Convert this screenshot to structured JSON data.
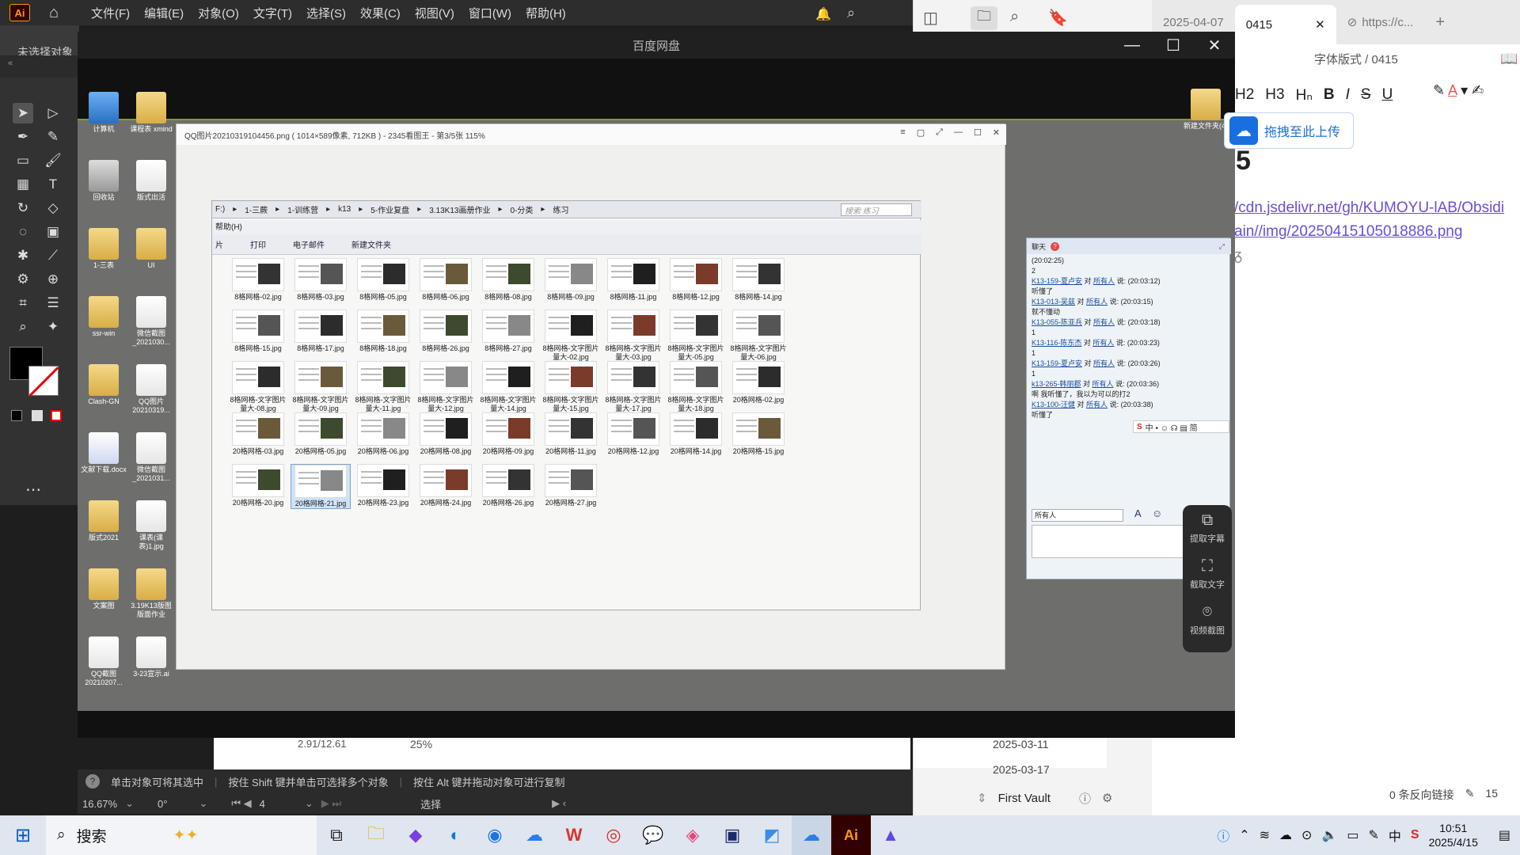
{
  "illustrator": {
    "logo": "Ai",
    "menus": [
      "文件(F)",
      "编辑(E)",
      "对象(O)",
      "文字(T)",
      "选择(S)",
      "效果(C)",
      "视图(V)",
      "窗口(W)",
      "帮助(H)"
    ],
    "no_selection": "未选择对象",
    "status": {
      "hint1": "单击对象可将其选中",
      "hint2": "按住 Shift 键并单击可选择多个对象",
      "hint3": "按住 Alt 键并拖动对象可进行复制"
    },
    "bottom": {
      "zoom": "16.67%",
      "rotate": "0°",
      "artboard": "4",
      "mode": "选择",
      "ruler_zero": "0"
    },
    "canvas_values": {
      "v1": "2.91/12.61",
      "v2": "25%"
    }
  },
  "obsidian": {
    "tabs": [
      {
        "label": "2025-04-07"
      },
      {
        "label": "0415",
        "active": true
      },
      {
        "label": "https://c..."
      }
    ],
    "breadcrumb": "字体版式 / 0415",
    "format_buttons": [
      "H2",
      "H3",
      "Hₙ",
      "B",
      "I",
      "S",
      "U"
    ],
    "heading": "5",
    "link_line1": "/cdn.jsdelivr.net/gh/KUMOYU-lAB/Obsidi",
    "link_line2": "ain//img/20250415105018886.png",
    "sidebar_dates": [
      "2025-03-11",
      "2025-03-17"
    ],
    "vault": "First Vault",
    "backlinks": "0 条反向链接",
    "word_count": "15"
  },
  "baidu": {
    "title": "百度网盘",
    "upload_label": "拖拽至此上传",
    "capture_tools": [
      "提取字幕",
      "截取文字",
      "视频截图"
    ]
  },
  "desktop_icons": [
    {
      "label": "计算机"
    },
    {
      "label": "课程表\nxmind"
    },
    {
      "label": "回收站"
    },
    {
      "label": "版式出活"
    },
    {
      "label": "1-三表"
    },
    {
      "label": "UI"
    },
    {
      "label": "ssr-win"
    },
    {
      "label": "微信截图_2021030..."
    },
    {
      "label": "Clash-GN"
    },
    {
      "label": "QQ图片20210319..."
    },
    {
      "label": "文献下载.docx"
    },
    {
      "label": "微信截图_2021031..."
    },
    {
      "label": "版式2021"
    },
    {
      "label": "课表(课表)1.jpg"
    },
    {
      "label": "文案图"
    },
    {
      "label": "3.19K13版图版面作业"
    },
    {
      "label": "QQ截图20210207..."
    },
    {
      "label": "3-23宣示.ai"
    }
  ],
  "right_desktop_icon": "新建文件夹(4)",
  "viewer": {
    "title": "QQ图片20210319104456.png ( 1014×589像素, 712KB ) - 2345看图王 - 第3/5张 115%"
  },
  "explorer": {
    "breadcrumb": [
      "F:)",
      "1-三蕨",
      "1-训练营",
      "k13",
      "5-作业复盘",
      "3.13K13画册作业",
      "0-分类",
      "练习"
    ],
    "search_placeholder": "搜索 练习",
    "menu": "帮助(H)",
    "toolbar": [
      "片",
      "打印",
      "电子邮件",
      "新建文件夹"
    ],
    "files": [
      "8格网格-02.jpg",
      "8格网格-03.jpg",
      "8格网格-05.jpg",
      "8格网格-06.jpg",
      "8格网格-08.jpg",
      "8格网格-09.jpg",
      "8格网格-11.jpg",
      "8格网格-12.jpg",
      "8格网格-14.jpg",
      "8格网格-15.jpg",
      "8格网格-17.jpg",
      "8格网格-18.jpg",
      "8格网格-26.jpg",
      "8格网格-27.jpg",
      "8格网格-文字图片量大-02.jpg",
      "8格网格-文字图片量大-03.jpg",
      "8格网格-文字图片量大-05.jpg",
      "8格网格-文字图片量大-06.jpg",
      "8格网格-文字图片量大-08.jpg",
      "8格网格-文字图片量大-09.jpg",
      "8格网格-文字图片量大-11.jpg",
      "8格网格-文字图片量大-12.jpg",
      "8格网格-文字图片量大-14.jpg",
      "8格网格-文字图片量大-15.jpg",
      "8格网格-文字图片量大-17.jpg",
      "8格网格-文字图片量大-18.jpg",
      "20格网格-02.jpg",
      "20格网格-03.jpg",
      "20格网格-05.jpg",
      "20格网格-06.jpg",
      "20格网格-08.jpg",
      "20格网格-09.jpg",
      "20格网格-11.jpg",
      "20格网格-12.jpg",
      "20格网格-14.jpg",
      "20格网格-15.jpg",
      "20格网格-20.jpg",
      "20格网格-21.jpg",
      "20格网格-23.jpg",
      "20格网格-24.jpg",
      "20格网格-26.jpg",
      "20格网格-27.jpg"
    ],
    "selected_index": 37
  },
  "chat": {
    "title": "聊天",
    "messages": [
      {
        "text": "(20:02:25)"
      },
      {
        "text": "2"
      },
      {
        "name": "K13-159-夏卢安",
        "to": "所有人",
        "time": "(20:03:12)"
      },
      {
        "text": "听懂了"
      },
      {
        "name": "K13-013-吴兹",
        "to": "所有人",
        "time": "(20:03:15)"
      },
      {
        "text": "就不懂动"
      },
      {
        "name": "K13-055-陈亚兵",
        "to": "所有人",
        "time": "(20:03:18)"
      },
      {
        "text": "1"
      },
      {
        "name": "K13-116-陈东杰",
        "to": "所有人",
        "time": "(20:03:23)"
      },
      {
        "text": "1"
      },
      {
        "name": "K13-159-夏卢安",
        "to": "所有人",
        "time": "(20:03:26)"
      },
      {
        "text": "1"
      },
      {
        "name": "k13-265-韩丽郡",
        "to": "所有人",
        "time": "(20:03:36)"
      },
      {
        "text": "啊 我听懂了，我以为可以的打2"
      },
      {
        "name": "K13-100-汪健",
        "to": "所有人",
        "time": "(20:03:38)"
      },
      {
        "text": "听懂了"
      }
    ],
    "recipient": "所有人"
  },
  "taskbar": {
    "search_label": "搜索",
    "ime": "中",
    "time": "10:51",
    "date": "2025/4/15"
  }
}
